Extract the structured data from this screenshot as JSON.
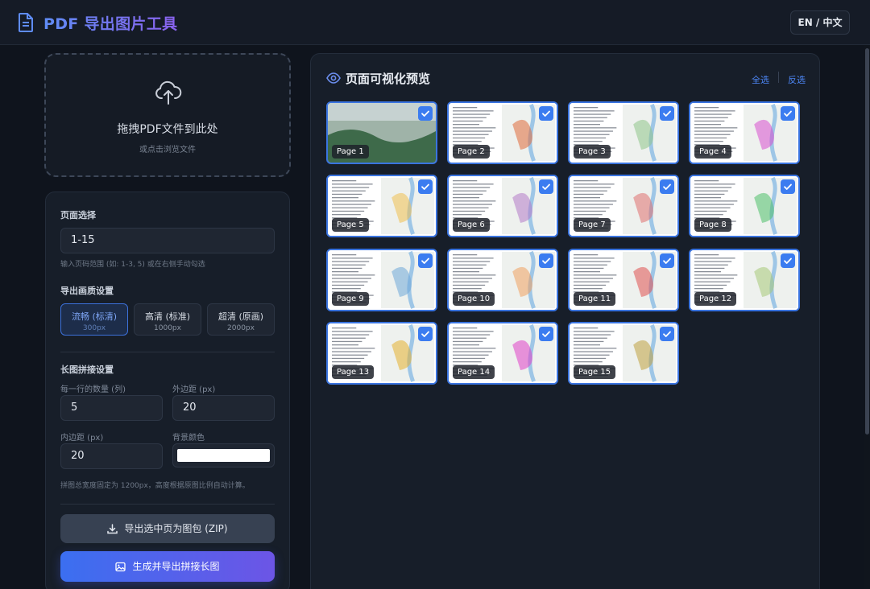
{
  "app": {
    "title": "PDF 导出图片工具",
    "lang_toggle": "EN / 中文"
  },
  "upload": {
    "title": "拖拽PDF文件到此处",
    "subtitle": "或点击浏览文件"
  },
  "settings": {
    "page_select_label": "页面选择",
    "page_range_value": "1-15",
    "page_range_hint": "输入页码范围 (如: 1-3, 5) 或在右侧手动勾选",
    "quality_label": "导出画质设置",
    "quality_options": [
      {
        "name": "流畅 (标清)",
        "res": "300px",
        "selected": true
      },
      {
        "name": "高清 (标准)",
        "res": "1000px",
        "selected": false
      },
      {
        "name": "超清 (原画)",
        "res": "2000px",
        "selected": false
      }
    ],
    "stitch_label": "长图拼接设置",
    "per_row_label": "每一行的数量 (列)",
    "per_row_value": "5",
    "outer_margin_label": "外边距 (px)",
    "outer_margin_value": "20",
    "inner_margin_label": "内边距 (px)",
    "inner_margin_value": "20",
    "bg_color_label": "背景颜色",
    "bg_color_value": "#ffffff",
    "stitch_hint": "拼图总宽度固定为 1200px，高度根据原图比例自动计算。",
    "export_zip_button": "导出选中页为图包 (ZIP)",
    "export_long_button": "生成并导出拼接长图"
  },
  "preview": {
    "title": "页面可视化预览",
    "select_all": "全选",
    "invert_select": "反选",
    "pages": [
      {
        "label": "Page 1",
        "checked": true
      },
      {
        "label": "Page 2",
        "checked": true
      },
      {
        "label": "Page 3",
        "checked": true
      },
      {
        "label": "Page 4",
        "checked": true
      },
      {
        "label": "Page 5",
        "checked": true
      },
      {
        "label": "Page 6",
        "checked": true
      },
      {
        "label": "Page 7",
        "checked": true
      },
      {
        "label": "Page 8",
        "checked": true
      },
      {
        "label": "Page 9",
        "checked": true
      },
      {
        "label": "Page 10",
        "checked": true
      },
      {
        "label": "Page 11",
        "checked": true
      },
      {
        "label": "Page 12",
        "checked": true
      },
      {
        "label": "Page 13",
        "checked": true
      },
      {
        "label": "Page 14",
        "checked": true
      },
      {
        "label": "Page 15",
        "checked": true
      }
    ]
  },
  "colors": {
    "accent": "#3b7cf0",
    "brand_gradient_start": "#5f8cf5",
    "brand_gradient_end": "#8a62ee"
  }
}
